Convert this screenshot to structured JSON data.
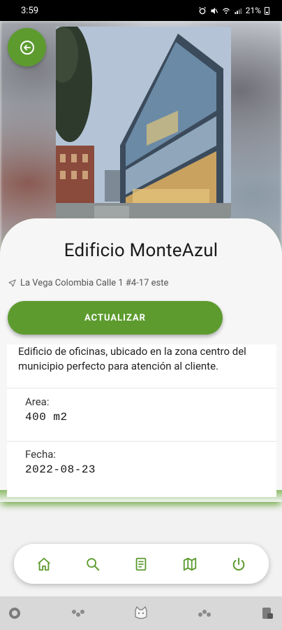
{
  "status": {
    "time": "3:59",
    "battery": "21%"
  },
  "building": {
    "name": "Edificio MonteAzul",
    "address": "La Vega Colombia Calle 1 #4-17 este",
    "description": "Edificio de oficinas, ubicado en la zona centro del municipio perfecto para atención al cliente."
  },
  "actions": {
    "update_label": "ACTUALIZAR"
  },
  "fields": [
    {
      "label": "Area:",
      "value": "400 m2"
    },
    {
      "label": "Fecha:",
      "value": "2022-08-23"
    }
  ],
  "nav": [
    "home-icon",
    "search-icon",
    "document-icon",
    "map-icon",
    "power-icon"
  ],
  "system_icons": [
    "app-icon-1",
    "app-icon-2",
    "app-icon-3",
    "app-icon-4",
    "app-icon-5"
  ],
  "colors": {
    "accent": "#5d9b2f",
    "card": "#f6f6f6"
  }
}
